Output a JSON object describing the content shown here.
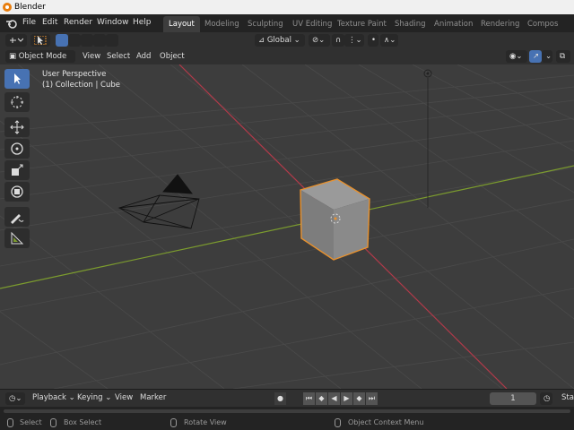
{
  "window": {
    "title": "Blender"
  },
  "menu": [
    "File",
    "Edit",
    "Render",
    "Window",
    "Help"
  ],
  "workspaces": [
    {
      "label": "Layout",
      "active": true
    },
    {
      "label": "Modeling"
    },
    {
      "label": "Sculpting"
    },
    {
      "label": "UV Editing"
    },
    {
      "label": "Texture Paint"
    },
    {
      "label": "Shading"
    },
    {
      "label": "Animation"
    },
    {
      "label": "Rendering"
    },
    {
      "label": "Compos"
    }
  ],
  "tool_header": {
    "orientation": "Global"
  },
  "view_header": {
    "mode": "Object Mode",
    "menus": [
      "View",
      "Select",
      "Add",
      "Object"
    ]
  },
  "viewport": {
    "perspective_label": "User Perspective",
    "collection_label": "(1) Collection | Cube",
    "colors": {
      "background": "#3d3d3d",
      "x_axis": "#b33a4a",
      "y_axis": "#7c9c2e",
      "selection": "#e8912d"
    }
  },
  "tools": [
    "select-box",
    "cursor",
    "move",
    "rotate",
    "scale",
    "transform",
    "annotate",
    "measure"
  ],
  "timeline": {
    "playback_label": "Playback",
    "keying_label": "Keying",
    "view_label": "View",
    "marker_label": "Marker",
    "current_frame": "1",
    "start_label": "Sta"
  },
  "statusbar": {
    "select": "Select",
    "box_select": "Box Select",
    "rotate_view": "Rotate View",
    "context_menu": "Object Context Menu"
  }
}
